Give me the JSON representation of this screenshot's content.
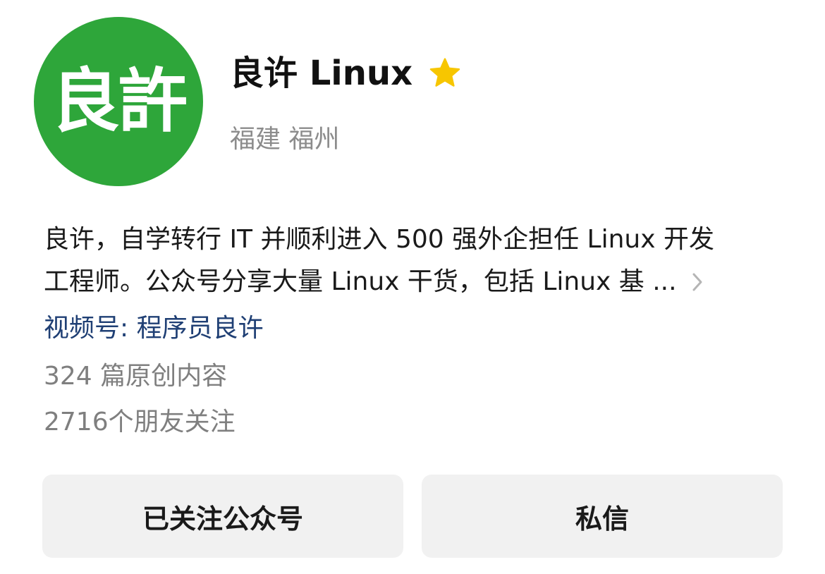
{
  "profile": {
    "avatar_text": "良許",
    "name": "良许 Linux",
    "starred_icon": "star-icon",
    "location": "福建 福州",
    "bio_line1": "良许，自学转行 IT 并顺利进入 500 强外企担任 Linux 开发",
    "bio_line2": "工程师。公众号分享大量 Linux 干货，包括 Linux 基 ...",
    "video_channel": "视频号: 程序员良许",
    "articles_count": "324 篇原创内容",
    "followers": "2716个朋友关注"
  },
  "actions": {
    "followed_label": "已关注公众号",
    "message_label": "私信"
  },
  "colors": {
    "avatar_bg": "#2ea63a",
    "star": "#f7c600",
    "video_link": "#1f3f74",
    "secondary_text": "#8c8c8c",
    "button_bg": "#f1f1f1"
  }
}
